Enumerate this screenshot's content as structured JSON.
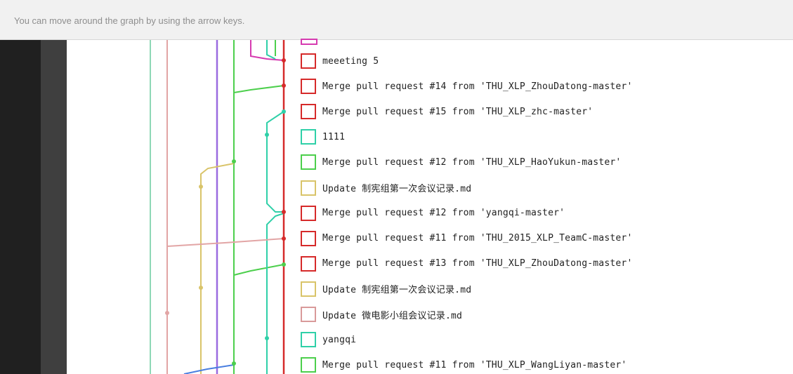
{
  "hint": {
    "text": "You can move around the graph by using the arrow keys."
  },
  "colors": {
    "red": "#d62a2a",
    "magenta": "#d63bb0",
    "green": "#4ccf4c",
    "teal": "#2fd0a8",
    "purple": "#9a6be0",
    "yellow": "#d9c46a",
    "pink": "#d99a9a",
    "blue": "#4a7fe0",
    "sea": "#8ed8b6"
  },
  "commits": [
    {
      "message": "meeeting 5",
      "color": "red",
      "icon": "commit-square-icon"
    },
    {
      "message": "Merge pull request #14 from 'THU_XLP_ZhouDatong-master'",
      "color": "red",
      "icon": "commit-square-icon"
    },
    {
      "message": "Merge pull request #15 from 'THU_XLP_zhc-master'",
      "color": "red",
      "icon": "commit-square-icon"
    },
    {
      "message": "1111",
      "color": "teal",
      "icon": "commit-square-icon"
    },
    {
      "message": "Merge pull request #12 from 'THU_XLP_HaoYukun-master'",
      "color": "green",
      "icon": "commit-square-icon"
    },
    {
      "message": "Update 制宪组第一次会议记录.md",
      "color": "yellow",
      "icon": "commit-square-icon"
    },
    {
      "message": "Merge pull request #12 from 'yangqi-master'",
      "color": "red",
      "icon": "commit-square-icon"
    },
    {
      "message": "Merge pull request #11 from 'THU_2015_XLP_TeamC-master'",
      "color": "red",
      "icon": "commit-square-icon"
    },
    {
      "message": "Merge pull request #13 from 'THU_XLP_ZhouDatong-master'",
      "color": "red",
      "icon": "commit-square-icon"
    },
    {
      "message": "Update 制宪组第一次会议记录.md",
      "color": "yellow",
      "icon": "commit-square-icon"
    },
    {
      "message": "Update 微电影小组会议记录.md",
      "color": "pink",
      "icon": "commit-square-icon"
    },
    {
      "message": "yangqi",
      "color": "teal",
      "icon": "commit-square-icon"
    },
    {
      "message": "Merge pull request #11 from 'THU_XLP_WangLiyan-master'",
      "color": "green",
      "icon": "commit-square-icon"
    }
  ]
}
